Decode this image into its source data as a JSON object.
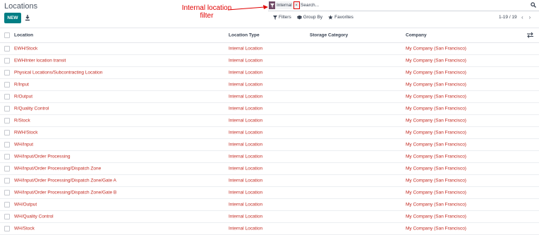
{
  "breadcrumb": {
    "title": "Locations"
  },
  "toolbar": {
    "new_label": "NEW",
    "download_icon": "download-icon"
  },
  "annotation": {
    "text": "Internal location filter",
    "color": "#e00000"
  },
  "search": {
    "facet_label": "Internal",
    "facet_icon": "filter-icon",
    "placeholder": "Search...",
    "value": ""
  },
  "controls": {
    "filters_label": "Filters",
    "groupby_label": "Group By",
    "favorites_label": "Favorites"
  },
  "pager": {
    "text": "1-19 / 19"
  },
  "table": {
    "columns": [
      "Location",
      "Location Type",
      "Storage Category",
      "Company"
    ],
    "rows": [
      {
        "location": "EWH/Stock",
        "type": "Internal Location",
        "storage": "",
        "company": "My Company (San Francisco)"
      },
      {
        "location": "EWH/inter location transit",
        "type": "Internal Location",
        "storage": "",
        "company": "My Company (San Francisco)"
      },
      {
        "location": "Physical Locations/Subcontracting Location",
        "type": "Internal Location",
        "storage": "",
        "company": "My Company (San Francisco)"
      },
      {
        "location": "R/Input",
        "type": "Internal Location",
        "storage": "",
        "company": "My Company (San Francisco)"
      },
      {
        "location": "R/Output",
        "type": "Internal Location",
        "storage": "",
        "company": "My Company (San Francisco)"
      },
      {
        "location": "R/Quality Control",
        "type": "Internal Location",
        "storage": "",
        "company": "My Company (San Francisco)"
      },
      {
        "location": "R/Stock",
        "type": "Internal Location",
        "storage": "",
        "company": "My Company (San Francisco)"
      },
      {
        "location": "RWH/Stock",
        "type": "Internal Location",
        "storage": "",
        "company": "My Company (San Francisco)"
      },
      {
        "location": "WH/Input",
        "type": "Internal Location",
        "storage": "",
        "company": "My Company (San Francisco)"
      },
      {
        "location": "WH/Input/Order Processing",
        "type": "Internal Location",
        "storage": "",
        "company": "My Company (San Francisco)"
      },
      {
        "location": "WH/Input/Order Processing/Dispatch Zone",
        "type": "Internal Location",
        "storage": "",
        "company": "My Company (San Francisco)"
      },
      {
        "location": "WH/Input/Order Processing/Dispatch Zone/Gate A",
        "type": "Internal Location",
        "storage": "",
        "company": "My Company (San Francisco)"
      },
      {
        "location": "WH/Input/Order Processing/Dispatch Zone/Gate B",
        "type": "Internal Location",
        "storage": "",
        "company": "My Company (San Francisco)"
      },
      {
        "location": "WH/Output",
        "type": "Internal Location",
        "storage": "",
        "company": "My Company (San Francisco)"
      },
      {
        "location": "WH/Quality Control",
        "type": "Internal Location",
        "storage": "",
        "company": "My Company (San Francisco)"
      },
      {
        "location": "WH/Stock",
        "type": "Internal Location",
        "storage": "",
        "company": "My Company (San Francisco)"
      }
    ]
  },
  "colors": {
    "accent": "#017e84",
    "link": "#c2281f",
    "facet": "#714b67"
  }
}
